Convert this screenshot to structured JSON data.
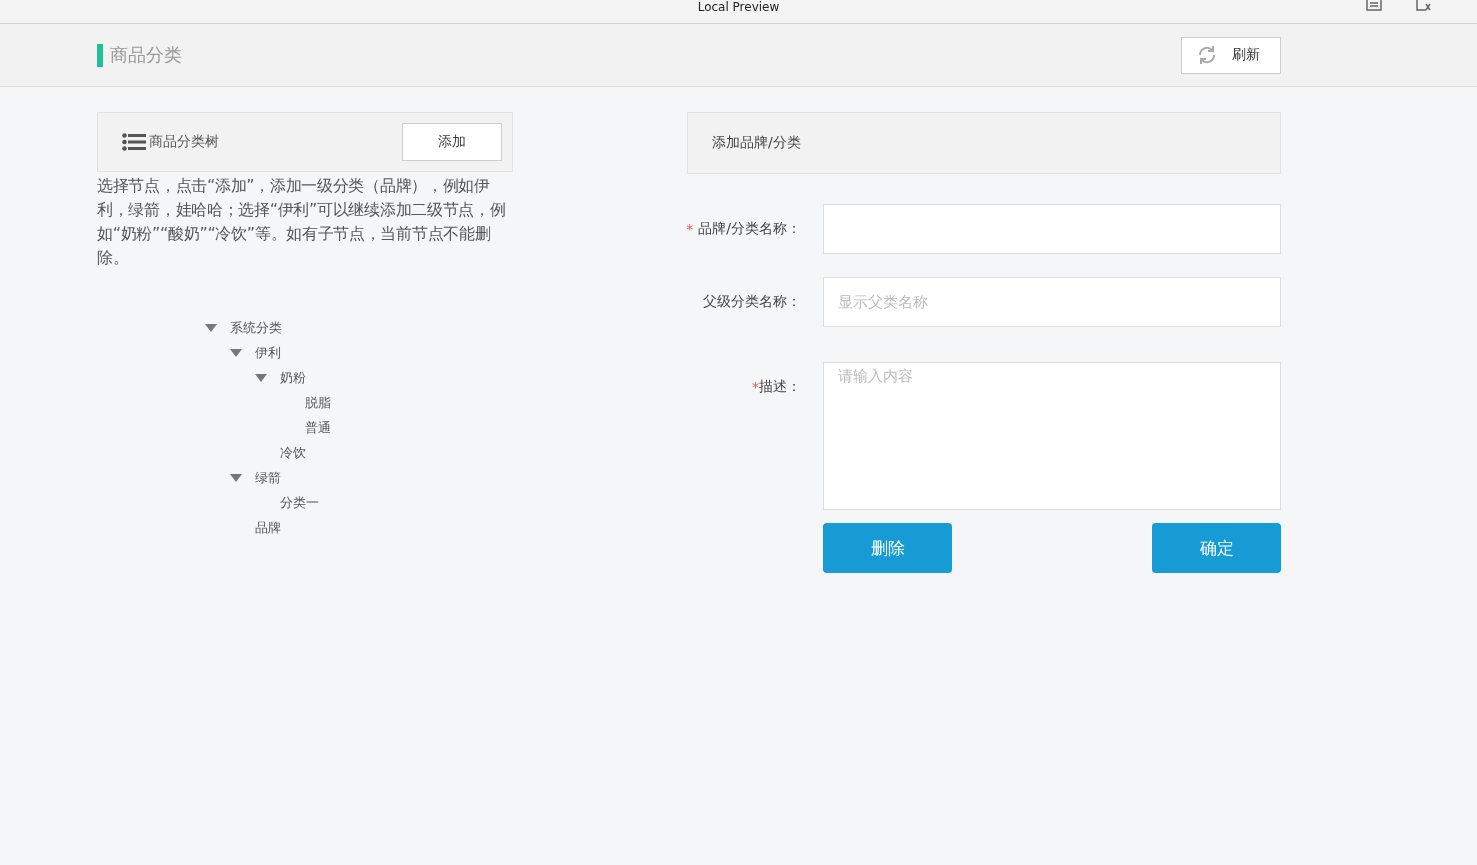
{
  "window": {
    "title": "Local Preview"
  },
  "header": {
    "title": "商品分类",
    "refresh_button": "刷新"
  },
  "tree_panel": {
    "title": "商品分类树",
    "add_button": "添加",
    "hint": "选择节点，点击“添加”，添加一级分类（品牌），例如伊利，绿箭，娃哈哈；选择“伊利”可以继续添加二级节点，例如“奶粉”“酸奶”“冷饮”等。如有子节点，当前节点不能删除。",
    "tree": [
      {
        "label": "系统分类",
        "expanded": true,
        "children": [
          {
            "label": "伊利",
            "expanded": true,
            "children": [
              {
                "label": "奶粉",
                "expanded": true,
                "children": [
                  {
                    "label": "脱脂"
                  },
                  {
                    "label": "普通"
                  }
                ]
              },
              {
                "label": "冷饮"
              }
            ]
          },
          {
            "label": "绿箭",
            "expanded": true,
            "children": [
              {
                "label": "分类一"
              }
            ]
          },
          {
            "label": "品牌"
          }
        ]
      }
    ]
  },
  "form": {
    "title": "添加品牌/分类",
    "fields": [
      {
        "kind": "input",
        "required_mark": "*",
        "label": "品牌/分类名称："
      },
      {
        "kind": "input",
        "label": "父级分类名称：",
        "placeholder": "显示父类名称"
      },
      {
        "kind": "textarea",
        "required_mark": "*",
        "label": "描述：",
        "placeholder": "请输入内容"
      }
    ],
    "buttons": [
      {
        "label": "删除"
      },
      {
        "label": "确定"
      }
    ]
  }
}
